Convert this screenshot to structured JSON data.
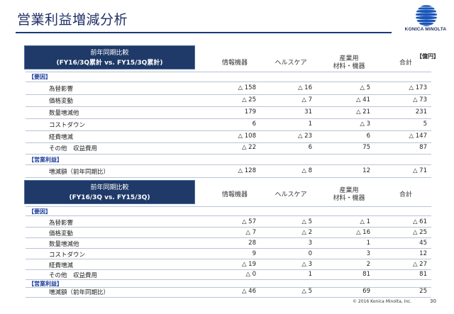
{
  "page": {
    "title": "営業利益増減分析",
    "page_number": "30",
    "copyright": "© 2016 Konica Minolta, Inc.",
    "logo_text": "KONICA MINOLTA"
  },
  "unit_label": "【億円】",
  "columns": {
    "c1": "情報機器",
    "c2": "ヘルスケア",
    "c3a": "産業用",
    "c3b": "材料・機器",
    "c4": "合計"
  },
  "section_labels": {
    "factors": "【要因】",
    "op": "【営業利益】"
  },
  "table1": {
    "header_l1": "前年同期比較",
    "header_l2": "(FY16/3Q累計  vs.  FY15/3Q累計)",
    "rows": [
      {
        "label": "為替影響",
        "v": [
          "△ 158",
          "△ 16",
          "△ 5",
          "△ 173"
        ]
      },
      {
        "label": "価格変動",
        "v": [
          "△ 25",
          "△ 7",
          "△ 41",
          "△ 73"
        ]
      },
      {
        "label": "数量増減他",
        "v": [
          "179",
          "31",
          "△ 21",
          "231"
        ]
      },
      {
        "label": "コストダウン",
        "v": [
          "6",
          "1",
          "△ 3",
          "5"
        ]
      },
      {
        "label": "経費増減",
        "v": [
          "△ 108",
          "△ 23",
          "6",
          "△ 147"
        ]
      },
      {
        "label": "その他　収益費用",
        "v": [
          "△ 22",
          "6",
          "75",
          "87"
        ]
      }
    ],
    "total": {
      "label": "増減額（前年同期比）",
      "v": [
        "△ 128",
        "△ 8",
        "12",
        "△ 71"
      ]
    }
  },
  "table2": {
    "header_l1": "前年同期比較",
    "header_l2": "(FY16/3Q  vs.  FY15/3Q)",
    "rows": [
      {
        "label": "為替影響",
        "v": [
          "△ 57",
          "△ 5",
          "△ 1",
          "△ 61"
        ]
      },
      {
        "label": "価格変動",
        "v": [
          "△ 7",
          "△ 2",
          "△ 16",
          "△ 25"
        ]
      },
      {
        "label": "数量増減他",
        "v": [
          "28",
          "3",
          "1",
          "45"
        ]
      },
      {
        "label": "コストダウン",
        "v": [
          "9",
          "0",
          "3",
          "12"
        ]
      },
      {
        "label": "経費増減",
        "v": [
          "△ 19",
          "△ 3",
          "2",
          "△ 27"
        ]
      },
      {
        "label": "その他　収益費用",
        "v": [
          "△ 0",
          "1",
          "81",
          "81"
        ]
      }
    ],
    "total": {
      "label": "増減額（前年同期比）",
      "v": [
        "△ 46",
        "△ 5",
        "69",
        "25"
      ]
    }
  },
  "colors": {
    "title": "#1f2f66",
    "header_box": "#1f3a68",
    "section": "#1a3a9a",
    "rule": "#b9c4d6",
    "logo_blue": "#1a56b8"
  }
}
